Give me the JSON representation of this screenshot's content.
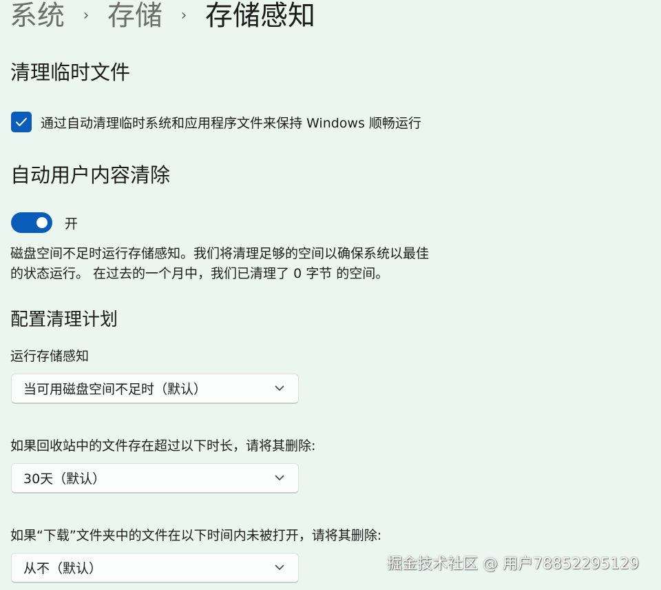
{
  "breadcrumb": {
    "items": [
      "系统",
      "存储",
      "存储感知"
    ],
    "separator": "›"
  },
  "sections": {
    "temp_files": {
      "title": "清理临时文件",
      "checkbox_label": "通过自动清理临时系统和应用程序文件来保持 Windows 顺畅运行",
      "checked": true
    },
    "auto_cleanup": {
      "title": "自动用户内容清除",
      "toggle_label": "开",
      "toggle_on": true,
      "description_line1": "磁盘空间不足时运行存储感知。我们将清理足够的空间以确保系统以最佳",
      "description_line2": "的状态运行。 在过去的一个月中，我们已清理了 0 字节 的空间。"
    },
    "schedule": {
      "title": "配置清理计划",
      "run_label": "运行存储感知",
      "run_value": "当可用磁盘空间不足时（默认）",
      "recycle_label": "如果回收站中的文件存在超过以下时长，请将其删除:",
      "recycle_value": "30天（默认）",
      "downloads_label": "如果“下载”文件夹中的文件在以下时间内未被打开，请将其删除:",
      "downloads_value": "从不（默认）"
    }
  },
  "watermark": "掘金技术社区 @ 用户78852295129",
  "icons": {
    "checkbox": "checkmark-icon",
    "dropdown": "chevron-down-icon",
    "breadcrumb_separator": "chevron-right-icon"
  },
  "colors": {
    "background": "#ebf6f1",
    "accent": "#0a5cb8",
    "text": "#1b1b1b",
    "breadcrumb_dim": "#6b6e6d"
  }
}
